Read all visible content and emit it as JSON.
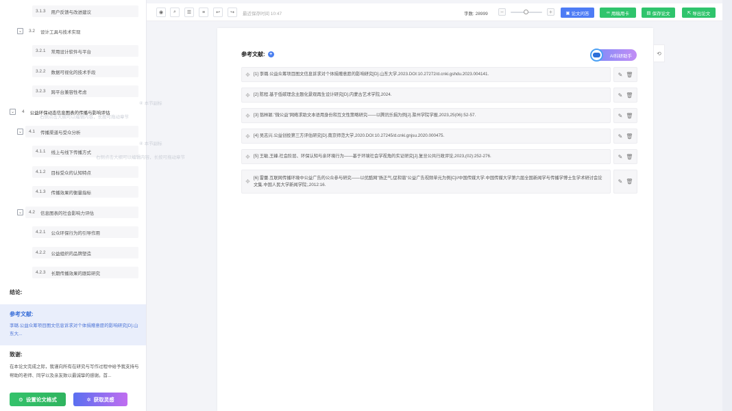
{
  "outline": {
    "rows": [
      {
        "num": "3.1.3",
        "label": "用户反馈与改进建议"
      },
      {
        "num": "3.2",
        "label": "设计工具与技术实现"
      },
      {
        "num": "3.2.1",
        "label": "常用设计软件与平台"
      },
      {
        "num": "3.2.2",
        "label": "数据可视化的技术手段"
      },
      {
        "num": "3.2.3",
        "label": "跨平台兼容性考虑"
      },
      {
        "num": "4",
        "label": "公益环保动态信息图表的传播与影响评估"
      },
      {
        "num": "4.1",
        "label": "传播渠道与受众分析"
      },
      {
        "num": "4.1.1",
        "label": "线上与线下传播方式"
      },
      {
        "num": "4.1.2",
        "label": "目标受众的认知特点"
      },
      {
        "num": "4.1.3",
        "label": "传播效果的衡量指标"
      },
      {
        "num": "4.2",
        "label": "信息图表的社会影响力评估"
      },
      {
        "num": "4.2.1",
        "label": "公众环保行为的引导作用"
      },
      {
        "num": "4.2.2",
        "label": "公益组织的品牌塑造"
      },
      {
        "num": "4.2.3",
        "label": "长期传播效果的跟踪研究"
      }
    ],
    "ghost_hints": [
      "④ 本节副标",
      "右侧点击大纲可以编辑内容，长按可拖动章节",
      "④ 本节副标",
      "右侧点击大纲可以编辑内容，长按可拖动章节"
    ],
    "conclusion_title": "结论:",
    "references": {
      "title": "参考文献:",
      "preview": "李璐.公益众筹项目图文信息诉求对个体捐赠意愿的影响研究[D].山东大..."
    },
    "thanks": {
      "title": "致谢:",
      "preview": "在本论文完成之际，我谨向所有在研究与写作过程中给予我支持与帮助的老师、同学以及亲友致以最诚挚的感谢。首..."
    },
    "buttons": {
      "format": "设置论文格式",
      "inspire": "获取灵感"
    }
  },
  "toolbar": {
    "saved_time": "最近保存时间 10:47",
    "word_count_label": "字数: ",
    "word_count": "28999",
    "zoom_level": 0.5,
    "actions": {
      "qa": "论文问答",
      "cards": "用稿用卡",
      "save": "保存论文",
      "export": "导出论文"
    },
    "colors": {
      "qa": "#4d7cf5",
      "cards": "#2fc46c",
      "save": "#2fc46c",
      "export": "#2fc46c"
    }
  },
  "doc": {
    "title": "参考文献:",
    "ai_assistant": "AI科研助手",
    "references": [
      "[1] 李璐.公益众筹项目图文信息诉求对个体捐赠意愿的影响研究[D].山东大学,2023.DOI:10.27272/d.cnki.gshdu.2023.004141.",
      "[2] 陈程.基于低碳理念主题化景观再生设计研究[D].内蒙古艺术学院,2024.",
      "[3] 翁林颖.\"微公益\"网络求助文本语用身份和互文性策略研究——以腾讯乐捐为例[J].滁州学院学报,2023,25(06):52-57.",
      "[4] 吴志兴.公益创投第三方评估研究[D].南京师范大学,2020.DOI:10.27245/d.cnki.gnjsu.2020.000475.",
      "[5] 王敏,王峰.社会阶层、环保认知与亲环境行为——基于环境社会学视角的实证研究[J].复旦公共行政评论,2023,(02):252-276.",
      "[6] 雷蕾.互联网传播环境中公益广告的公众参与研究——以优酷网\"扬正气,促和谐\"公益广告视频单元为例[C]//中国传媒大学.中国传媒大学第六届全国新闻学与传播学博士生学术研讨会论文集.中国人民大学新闻学院;,2012:16."
    ]
  }
}
